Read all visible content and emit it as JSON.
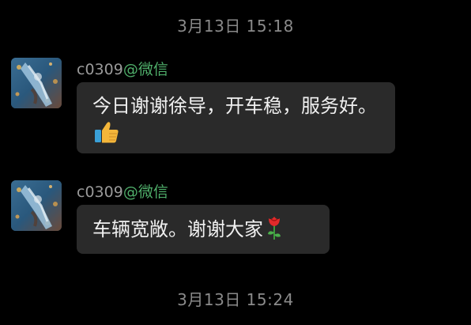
{
  "chat": {
    "timestamps": {
      "top": "3月13日  15:18",
      "bottom": "3月13日  15:24"
    },
    "messages": [
      {
        "sender_name": "c0309",
        "sender_source": "@微信",
        "text": "今日谢谢徐导，开车稳，服务好。",
        "emoji": "thumbs-up-icon"
      },
      {
        "sender_name": "c0309",
        "sender_source": "@微信",
        "text": "车辆宽敞。谢谢大家",
        "emoji": "rose-icon"
      }
    ]
  },
  "colors": {
    "background": "#000000",
    "bubble": "#2a2a2a",
    "timestamp": "#8a8a8a",
    "sender_name": "#9a9a9a",
    "sender_source": "#4fae6a",
    "message_text": "#f0f0f0"
  }
}
